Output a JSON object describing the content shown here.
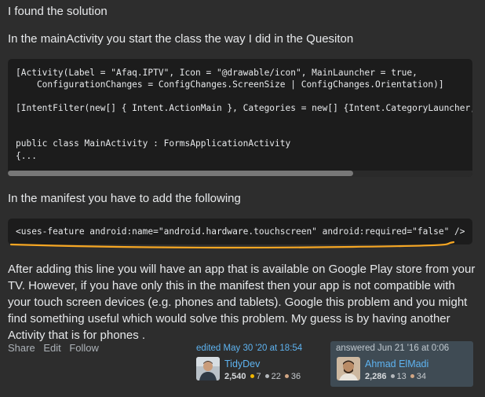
{
  "answer": {
    "para1": "I found the solution",
    "para2": "In the mainActivity you start the class the way I did in the Quesiton",
    "code_block_1": [
      "[Activity(Label = \"Afaq.IPTV\", Icon = \"@drawable/icon\", MainLauncher = true,",
      "    ConfigurationChanges = ConfigChanges.ScreenSize | ConfigChanges.Orientation)]",
      "",
      "[IntentFilter(new[] { Intent.ActionMain }, Categories = new[] {Intent.CategoryLauncher,Inte",
      "",
      "",
      "public class MainActivity : FormsApplicationActivity",
      "{..."
    ],
    "para3": "In the manifest you have to add the following",
    "code_block_2": "<uses-feature android:name=\"android.hardware.touchscreen\" android:required=\"false\" />",
    "para4": "After adding this line you will have an app that is available on Google Play store from your TV. However, if you have only this in the manifest then your app is not compatible with your touch screen devices (e.g. phones and tablets). Google this problem and you might find something useful which would solve this problem. My guess is by having another Activity that is for phones ."
  },
  "post_actions": {
    "share": "Share",
    "edit": "Edit",
    "follow": "Follow"
  },
  "edited": {
    "label": "edited May 30 '20 at 18:54",
    "user": "TidyDev",
    "reputation": "2,540",
    "gold": "7",
    "silver": "22",
    "bronze": "36"
  },
  "answered": {
    "label": "answered Jun 21 '16 at 0:06",
    "user": "Ahmad ElMadi",
    "reputation": "2,286",
    "silver": "13",
    "bronze": "34"
  },
  "colors": {
    "link": "#5eb3f0",
    "gold": "#f1b600",
    "silver": "#b4b8bc",
    "bronze": "#d1a684",
    "underline": "#f5a623"
  }
}
